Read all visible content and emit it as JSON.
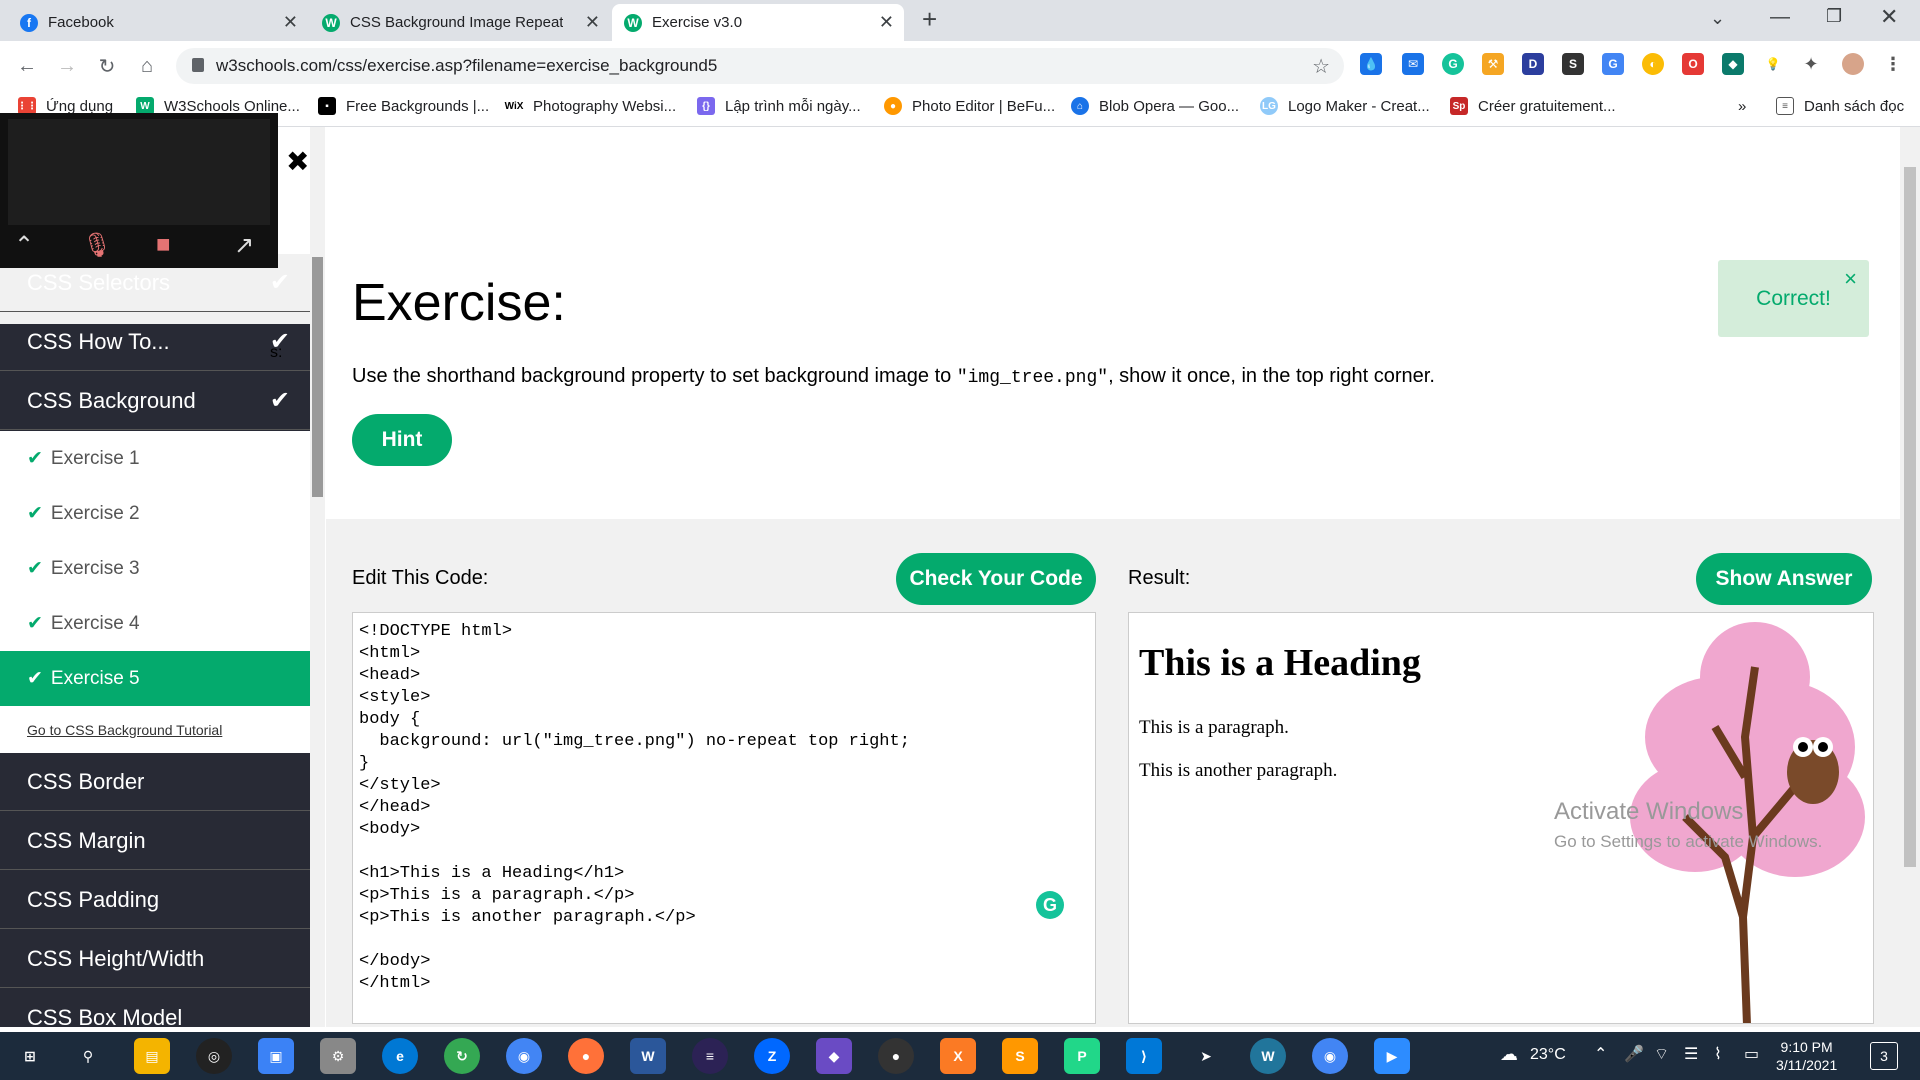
{
  "browser": {
    "tabs": [
      {
        "title": "Facebook",
        "icon": "facebook-icon",
        "color": "#1877f2"
      },
      {
        "title": "CSS Background Image Repeat",
        "icon": "w3schools-icon",
        "color": "#04AA6D"
      },
      {
        "title": "Exercise v3.0",
        "icon": "w3schools-icon",
        "color": "#04AA6D"
      }
    ],
    "new_tab": "+",
    "url": "w3schools.com/css/exercise.asp?filename=exercise_background5",
    "bookmarks": [
      "Ứng dụng",
      "W3Schools Online...",
      "Free Backgrounds |...",
      "Photography Websi...",
      "Lập trình mỗi ngày...",
      "Photo Editor | BeFu...",
      "Blob Opera — Goo...",
      "Logo Maker - Creat...",
      "Créer gratuitement..."
    ],
    "reading_list": "Danh sách đọc",
    "more_bookmarks": "»"
  },
  "sidebar": {
    "top_items": [
      {
        "label": "CSS Selectors",
        "done": true
      },
      {
        "label": "CSS How To...",
        "done": true
      },
      {
        "label": "CSS Background",
        "done": true
      }
    ],
    "exercises": [
      {
        "label": "Exercise 1",
        "active": false
      },
      {
        "label": "Exercise 2",
        "active": false
      },
      {
        "label": "Exercise 3",
        "active": false
      },
      {
        "label": "Exercise 4",
        "active": false
      },
      {
        "label": "Exercise 5",
        "active": true
      }
    ],
    "tutorial_link": "Go to CSS Background Tutorial",
    "bottom_items": [
      "CSS Border",
      "CSS Margin",
      "CSS Padding",
      "CSS Height/Width",
      "CSS Box Model"
    ],
    "partial_label": "s:"
  },
  "exercise": {
    "title": "Exercise:",
    "description_before": "Use the shorthand background property to set background image to ",
    "description_code": "\"img_tree.png\"",
    "description_after": ", show it once, in the top right corner.",
    "hint_button": "Hint",
    "feedback": "Correct!",
    "feedback_close": "×"
  },
  "editor": {
    "label": "Edit This Code:",
    "check_button": "Check Your Code",
    "code": "<!DOCTYPE html>\n<html>\n<head>\n<style>\nbody {\n  background: url(\"img_tree.png\") no-repeat top right;\n}\n</style>\n</head>\n<body>\n\n<h1>This is a Heading</h1>\n<p>This is a paragraph.</p>\n<p>This is another paragraph.</p>\n\n</body>\n</html>"
  },
  "result": {
    "label": "Result:",
    "show_answer_button": "Show Answer",
    "heading": "This is a Heading",
    "paragraph1": "This is a paragraph.",
    "paragraph2": "This is another paragraph."
  },
  "watermark": {
    "line1": "Activate Windows",
    "line2": "Go to Settings to activate Windows."
  },
  "taskbar": {
    "weather": "23°C",
    "time": "9:10 PM",
    "date": "3/11/2021",
    "notifications": "3"
  },
  "colors": {
    "accent": "#04AA6D",
    "sidebar_bg": "#282A35",
    "correct_bg": "#d4edda"
  }
}
